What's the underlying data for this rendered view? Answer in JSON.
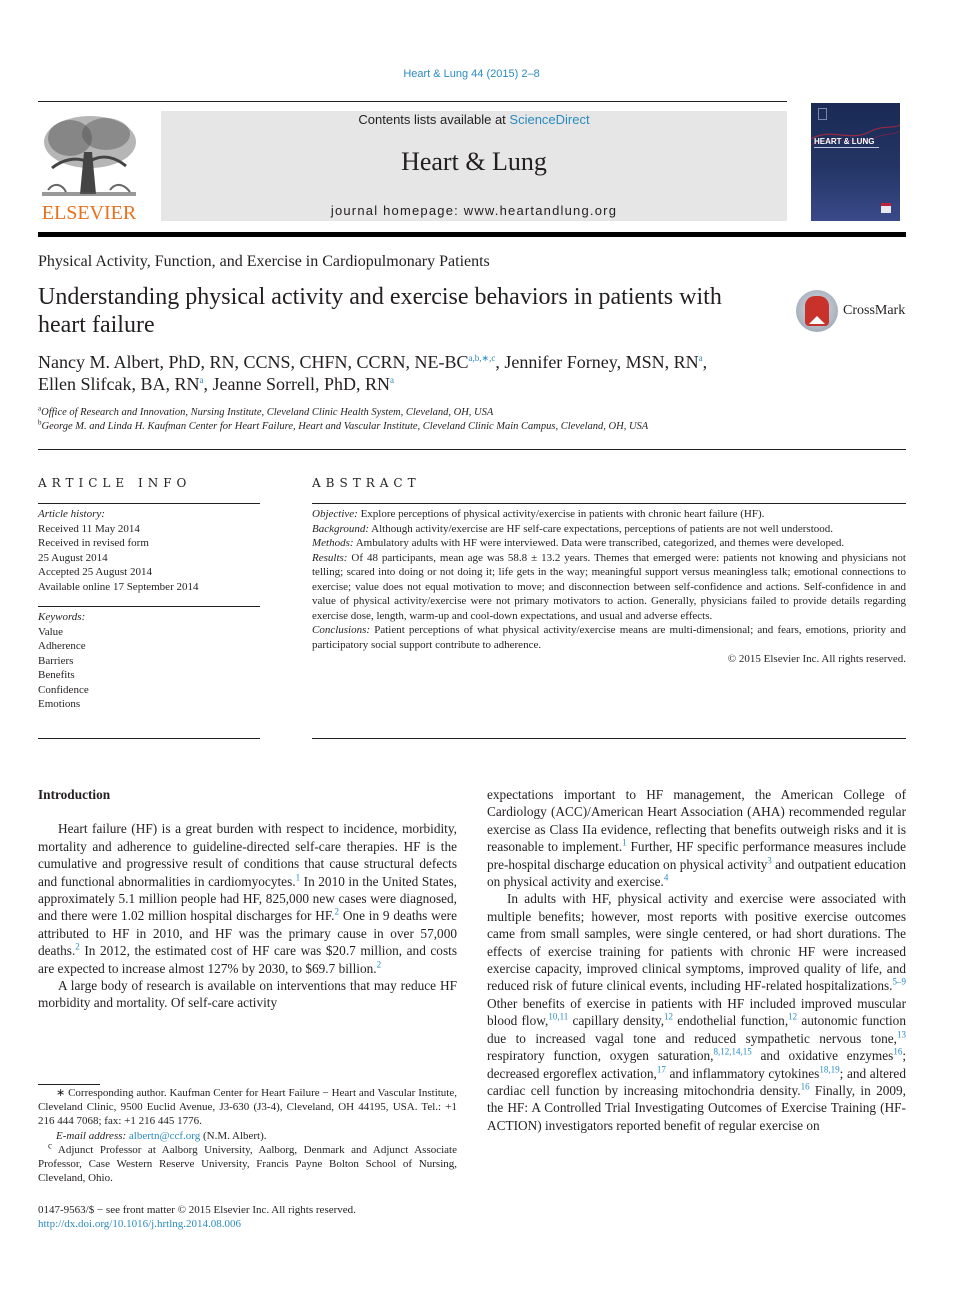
{
  "citation": "Heart & Lung 44 (2015) 2–8",
  "banner": {
    "contents_prefix": "Contents lists available at ",
    "contents_link": "ScienceDirect",
    "journal_name": "Heart & Lung",
    "homepage": "journal homepage: www.heartandlung.org"
  },
  "publisher_logo": {
    "wordmark": "ELSEVIER",
    "icon": "tree-icon",
    "color": "#e9711c"
  },
  "cover": {
    "title": "HEART & LUNG",
    "icon": "journal-cover-image"
  },
  "section_label": "Physical Activity, Function, and Exercise in Cardiopulmonary Patients",
  "title": "Understanding physical activity and exercise behaviors in patients with heart failure",
  "crossmark": {
    "label": "CrossMark",
    "icon": "crossmark-icon"
  },
  "authors": [
    {
      "name": "Nancy M. Albert, PhD, RN, CCNS, CHFN, CCRN, NE-BC",
      "marks": "a,b,∗,c",
      "sep": ", "
    },
    {
      "name": "Jennifer Forney, MSN, RN",
      "marks": "a",
      "sep": ","
    },
    {
      "name": "Ellen Slifcak, BA, RN",
      "marks": "a",
      "sep": ", "
    },
    {
      "name": "Jeanne Sorrell, PhD, RN",
      "marks": "a",
      "sep": ""
    }
  ],
  "affiliations": [
    {
      "mark": "a",
      "text": "Office of Research and Innovation, Nursing Institute, Cleveland Clinic Health System, Cleveland, OH, USA"
    },
    {
      "mark": "b",
      "text": "George M. and Linda H. Kaufman Center for Heart Failure, Heart and Vascular Institute, Cleveland Clinic Main Campus, Cleveland, OH, USA"
    }
  ],
  "article_info": {
    "heading": "ARTICLE INFO",
    "history_label": "Article history:",
    "history": [
      "Received 11 May 2014",
      "Received in revised form",
      "25 August 2014",
      "Accepted 25 August 2014",
      "Available online 17 September 2014"
    ],
    "keywords_label": "Keywords:",
    "keywords": [
      "Value",
      "Adherence",
      "Barriers",
      "Benefits",
      "Confidence",
      "Emotions"
    ]
  },
  "abstract": {
    "heading": "ABSTRACT",
    "sections": [
      {
        "label": "Objective:",
        "text": " Explore perceptions of physical activity/exercise in patients with chronic heart failure (HF)."
      },
      {
        "label": "Background:",
        "text": " Although activity/exercise are HF self-care expectations, perceptions of patients are not well understood."
      },
      {
        "label": "Methods:",
        "text": " Ambulatory adults with HF were interviewed. Data were transcribed, categorized, and themes were developed."
      },
      {
        "label": "Results:",
        "text": " Of 48 participants, mean age was 58.8 ± 13.2 years. Themes that emerged were: patients not knowing and physicians not telling; scared into doing or not doing it; life gets in the way; meaningful support versus meaningless talk; emotional connections to exercise; value does not equal motivation to move; and disconnection between self-confidence and actions. Self-confidence in and value of physical activity/exercise were not primary motivators to action. Generally, physicians failed to provide details regarding exercise dose, length, warm-up and cool-down expectations, and usual and adverse effects."
      },
      {
        "label": "Conclusions:",
        "text": " Patient perceptions of what physical activity/exercise means are multi-dimensional; and fears, emotions, priority and participatory social support contribute to adherence."
      }
    ],
    "copyright": "© 2015 Elsevier Inc. All rights reserved."
  },
  "body": {
    "intro_heading": "Introduction",
    "left_p1": [
      {
        "t": "Heart failure (HF) is a great burden with respect to incidence, morbidity, mortality and adherence to guideline-directed self-care therapies. HF is the cumulative and progressive result of conditions that cause structural defects and functional abnormalities in cardiomyocytes."
      },
      {
        "r": "1"
      },
      {
        "t": " In 2010 in the United States, approximately 5.1 million people had HF, 825,000 new cases were diagnosed, and there were 1.02 million hospital discharges for HF."
      },
      {
        "r": "2"
      },
      {
        "t": " One in 9 deaths were attributed to HF in 2010, and HF was the primary cause in over 57,000 deaths."
      },
      {
        "r": "2"
      },
      {
        "t": " In 2012, the estimated cost of HF care was $20.7 million, and costs are expected to increase almost 127% by 2030, to $69.7 billion."
      },
      {
        "r": "2"
      }
    ],
    "left_p2": "A large body of research is available on interventions that may reduce HF morbidity and mortality. Of self-care activity",
    "right_p1": [
      {
        "t": "expectations important to HF management, the American College of Cardiology (ACC)/American Heart Association (AHA) recommended regular exercise as Class IIa evidence, reflecting that benefits outweigh risks and it is reasonable to implement."
      },
      {
        "r": "1"
      },
      {
        "t": " Further, HF specific performance measures include pre-hospital discharge education on physical activity"
      },
      {
        "r": "3"
      },
      {
        "t": " and outpatient education on physical activity and exercise."
      },
      {
        "r": "4"
      }
    ],
    "right_p2": [
      {
        "t": "In adults with HF, physical activity and exercise were associated with multiple benefits; however, most reports with positive exercise outcomes came from small samples, were single centered, or had short durations. The effects of exercise training for patients with chronic HF were increased exercise capacity, improved clinical symptoms, improved quality of life, and reduced risk of future clinical events, including HF-related hospitalizations."
      },
      {
        "r": "5–9"
      },
      {
        "t": " Other benefits of exercise in patients with HF included improved muscular blood flow,"
      },
      {
        "r": "10,11"
      },
      {
        "t": " capillary density,"
      },
      {
        "r": "12"
      },
      {
        "t": " endothelial function,"
      },
      {
        "r": "12"
      },
      {
        "t": " autonomic function due to increased vagal tone and reduced sympathetic nervous tone,"
      },
      {
        "r": "13"
      },
      {
        "t": " respiratory function, oxygen saturation,"
      },
      {
        "r": "8,12,14,15"
      },
      {
        "t": " and oxidative enzymes"
      },
      {
        "r": "16"
      },
      {
        "t": "; decreased ergoreflex activation,"
      },
      {
        "r": "17"
      },
      {
        "t": " and inflammatory cytokines"
      },
      {
        "r": "18,19"
      },
      {
        "t": "; and altered cardiac cell function by increasing mitochondria density."
      },
      {
        "r": "16"
      },
      {
        "t": " Finally, in 2009, the HF: A Controlled Trial Investigating Outcomes of Exercise Training (HF-ACTION) investigators reported benefit of regular exercise on"
      }
    ]
  },
  "footnotes": {
    "corresponding": "∗ Corresponding author. Kaufman Center for Heart Failure − Heart and Vascular Institute, Cleveland Clinic, 9500 Euclid Avenue, J3-630 (J3-4), Cleveland, OH 44195, USA. Tel.: +1 216 444 7068; fax: +1 216 445 1776.",
    "email_label": "E-mail address:",
    "email": "albertn@ccf.org",
    "email_suffix": " (N.M. Albert).",
    "adjunct_mark": "c",
    "adjunct": " Adjunct Professor at Aalborg University, Aalborg, Denmark and Adjunct Associate Professor, Case Western Reserve University, Francis Payne Bolton School of Nursing, Cleveland, Ohio."
  },
  "front_matter": "0147-9563/$ − see front matter © 2015 Elsevier Inc. All rights reserved.",
  "doi": "http://dx.doi.org/10.1016/j.hrtlng.2014.08.006",
  "colors": {
    "link": "#2a8bbf",
    "elsevier_orange": "#e9711c",
    "banner_bg": "#e6e6e6"
  }
}
